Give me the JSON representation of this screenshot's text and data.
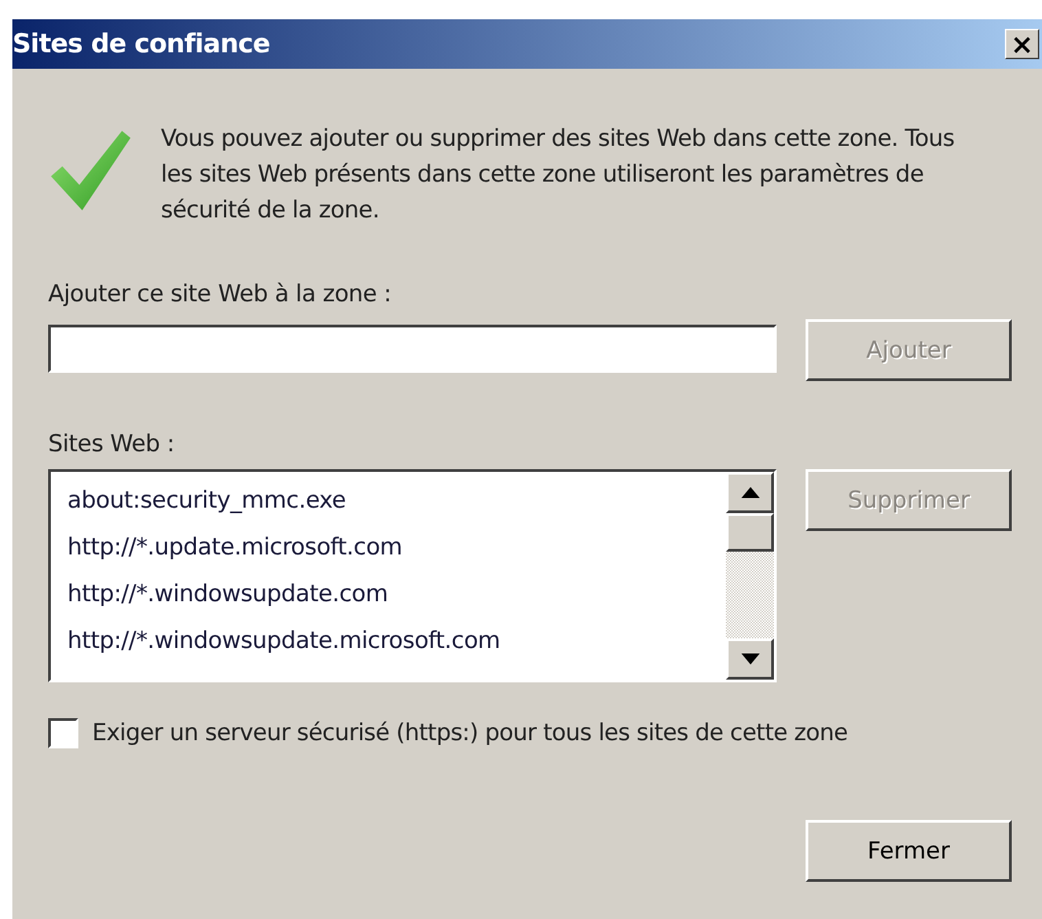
{
  "window": {
    "title": "Sites de confiance",
    "close": "×"
  },
  "message": "Vous pouvez ajouter ou supprimer des sites Web dans cette zone. Tous les sites Web présents dans cette zone utiliseront les paramètres de sécurité de la zone.",
  "add": {
    "label": "Ajouter ce site Web à la zone :",
    "button": {
      "label": "Ajouter",
      "disabled": true
    }
  },
  "sites": {
    "label": "Sites Web :",
    "items": [
      {
        "text": "about:security_mmc.exe",
        "selected": false
      },
      {
        "text": "http://*.update.microsoft.com",
        "selected": false
      },
      {
        "text": "http://*.windowsupdate.com",
        "selected": false
      },
      {
        "text": "http://*.windowsupdate.microsoft.com",
        "selected": false
      }
    ],
    "button": {
      "label": "Supprimer",
      "disabled": true
    }
  },
  "https_required": {
    "label": "Exiger un serveur sécurisé (https:) pour tous les sites de cette zone",
    "checked": false
  },
  "close_button": {
    "label": "Fermer",
    "disabled": false
  }
}
